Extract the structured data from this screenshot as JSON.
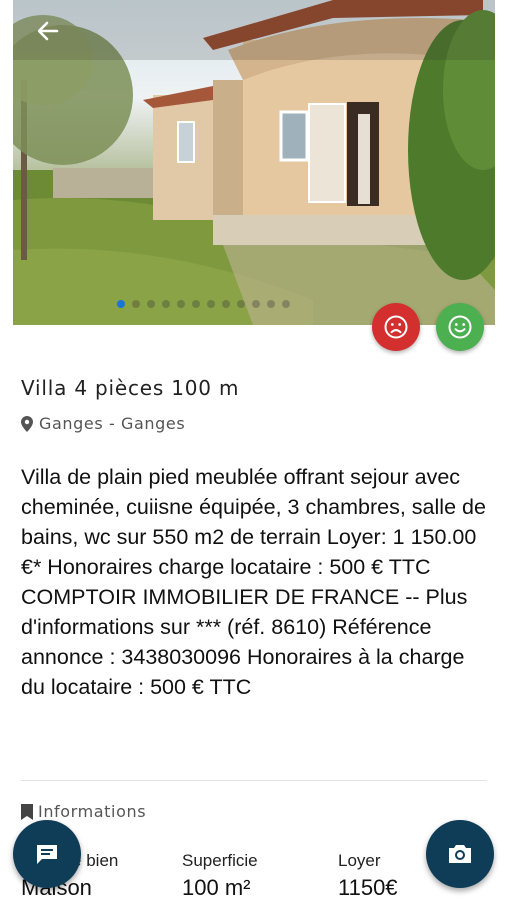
{
  "listing": {
    "title": "Villa 4 pièces 100 m",
    "location": "Ganges - Ganges",
    "description": "Villa de plain pied meublée offrant sejour avec cheminée, cuiisne équipée, 3 chambres, salle de bains, wc sur 550 m2 de terrain Loyer: 1 150.00 €* Honoraires charge locataire : 500 € TTC COMPTOIR IMMOBILIER DE FRANCE -- Plus d'informations sur *** (réf. 8610) Référence annonce : 3438030096 Honoraires à la charge du locataire : 500 € TTC"
  },
  "gallery": {
    "photo_count": 12,
    "active_index": 0,
    "active_color": "#1976d2"
  },
  "reactions": {
    "dislike_color": "#d32f2f",
    "like_color": "#4caf50"
  },
  "informations": {
    "heading": "Informations",
    "items": [
      {
        "label": "Type de bien",
        "value": "Maison"
      },
      {
        "label": "Superficie",
        "value": "100 m²"
      },
      {
        "label": "Loyer",
        "value": "1150€"
      }
    ]
  },
  "icons": {
    "back": "arrow-left-icon",
    "location": "map-pin-icon",
    "section": "bookmark-icon",
    "chat": "chat-icon",
    "camera": "camera-icon"
  },
  "fab_color": "#0f3d57"
}
